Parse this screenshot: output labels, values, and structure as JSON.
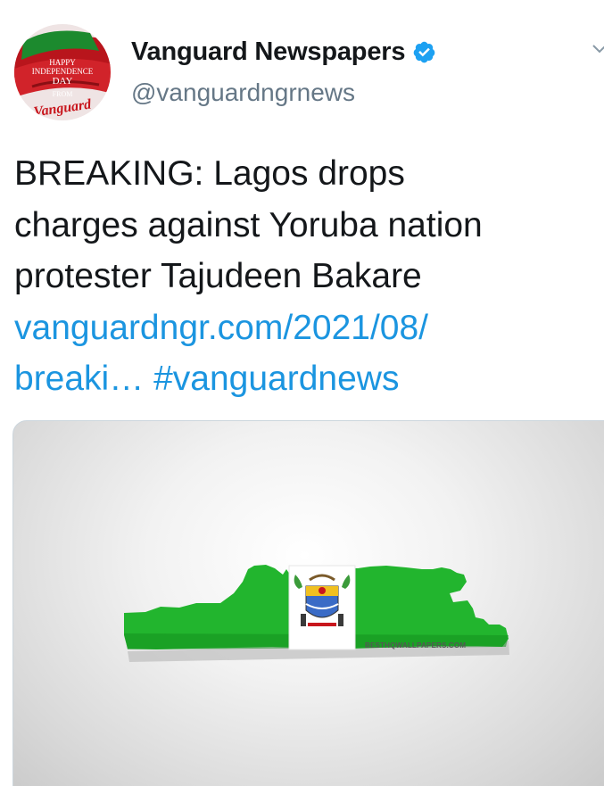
{
  "user": {
    "display_name": "Vanguard Newspapers",
    "handle": "@vanguardngrnews",
    "verified": true,
    "avatar": {
      "line1": "HAPPY",
      "line2": "INDEPENDENCE",
      "line3": "DAY",
      "line4": "FROM",
      "brand": "Vanguard"
    }
  },
  "tweet": {
    "lines": [
      "BREAKING: Lagos drops",
      "charges against Yoruba nation",
      "protester Tajudeen Bakare"
    ],
    "link_line1": "vanguardngr.com/2021/08/",
    "link_line2_url": "breaki…",
    "hashtag": "#vanguardnews"
  },
  "media": {
    "watermark": "BESTHQWALLPAPERS.COM"
  },
  "colors": {
    "link": "#1b95e0",
    "verified": "#1da1f2",
    "flag_green": "#1fb52b"
  },
  "icons": {
    "verified": "verified-badge-icon",
    "menu": "chevron-down-icon"
  }
}
